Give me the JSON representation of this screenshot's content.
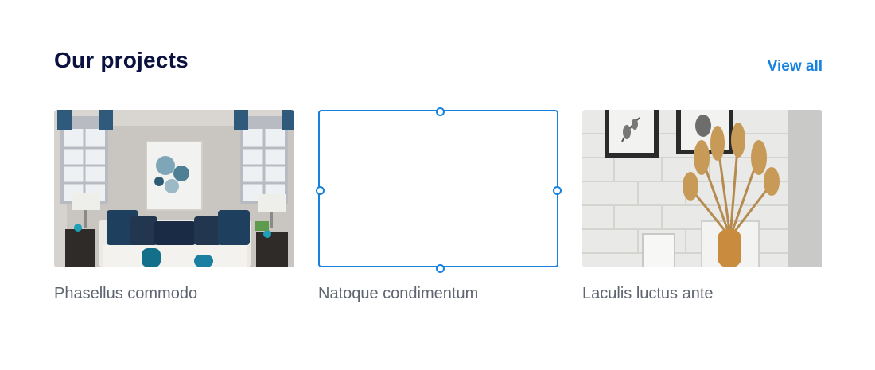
{
  "section": {
    "title": "Our projects",
    "view_all_label": "View all"
  },
  "projects": [
    {
      "caption": "Phasellus commodo",
      "image": "living-room-photo"
    },
    {
      "caption": "Natoque condimentum",
      "image": "selected-empty-placeholder"
    },
    {
      "caption": "Laculis luctus ante",
      "image": "dried-flowers-brick-wall-photo"
    }
  ],
  "colors": {
    "title": "#0b1240",
    "accent": "#1781e0",
    "caption": "#5f6570"
  }
}
